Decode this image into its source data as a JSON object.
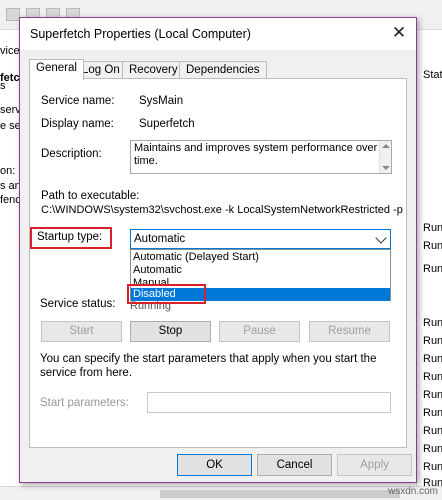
{
  "background": {
    "left_fragments": [
      "vice",
      "s",
      "fetch",
      "serv",
      "e se",
      "on:",
      "s and",
      "fence"
    ],
    "status_header": "Stat",
    "status_cells": [
      "Run",
      "Run",
      "Run",
      "Run",
      "Run",
      "Run",
      "Run",
      "Run",
      "Run",
      "Run",
      "Run",
      "Run",
      "Run"
    ]
  },
  "dialog": {
    "title": "Superfetch Properties (Local Computer)",
    "close_glyph": "✕",
    "tabs": [
      {
        "label": "General",
        "active": true
      },
      {
        "label": "Log On",
        "active": false
      },
      {
        "label": "Recovery",
        "active": false
      },
      {
        "label": "Dependencies",
        "active": false
      }
    ],
    "service_name_label": "Service name:",
    "service_name_value": "SysMain",
    "display_name_label": "Display name:",
    "display_name_value": "Superfetch",
    "description_label": "Description:",
    "description_value": "Maintains and improves system performance over time.",
    "path_label": "Path to executable:",
    "path_value": "C:\\WINDOWS\\system32\\svchost.exe -k LocalSystemNetworkRestricted -p",
    "startup_type_label": "Startup type:",
    "startup_type_value": "Automatic",
    "startup_options": [
      {
        "label": "Automatic (Delayed Start)",
        "selected": false
      },
      {
        "label": "Automatic",
        "selected": false
      },
      {
        "label": "Manual",
        "selected": false
      },
      {
        "label": "Disabled",
        "selected": true
      }
    ],
    "service_status_label": "Service status:",
    "service_status_value": "Running",
    "service_buttons": {
      "start": "Start",
      "stop": "Stop",
      "pause": "Pause",
      "resume": "Resume"
    },
    "hint_text": "You can specify the start parameters that apply when you start the service from here.",
    "start_params_label": "Start parameters:",
    "start_params_value": "",
    "footer_buttons": {
      "ok": "OK",
      "cancel": "Cancel",
      "apply": "Apply"
    }
  },
  "watermark": "wsxdn.com",
  "colors": {
    "accent": "#0078d7",
    "highlight_box": "#d6202a",
    "dialog_border": "#8c3e8a"
  }
}
